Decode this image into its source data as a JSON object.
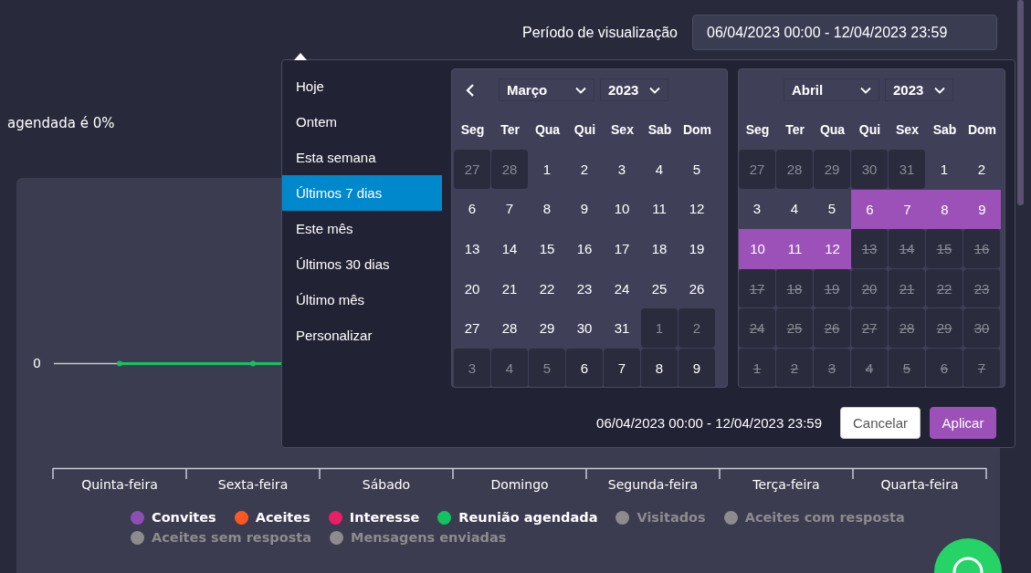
{
  "header": {
    "label": "Período de visualização",
    "range_value": "06/04/2023 00:00 - 12/04/2023 23:59"
  },
  "summary": "agendada é 0%",
  "chart": {
    "y_tick": "0",
    "x_labels": [
      "Quinta-feira",
      "Sexta-feira",
      "Sábado",
      "Domingo",
      "Segunda-feira",
      "Terça-feira",
      "Quarta-feira"
    ],
    "legend": [
      {
        "label": "Convites",
        "color": "#8e4fb5",
        "enabled": true
      },
      {
        "label": "Aceites",
        "color": "#ff5722",
        "enabled": true
      },
      {
        "label": "Interesse",
        "color": "#e91e63",
        "enabled": true
      },
      {
        "label": "Reunião agendada",
        "color": "#13c360",
        "enabled": true
      },
      {
        "label": "Visitados",
        "color": "#8c8c8c",
        "enabled": false
      },
      {
        "label": "Aceites com resposta",
        "color": "#8c8c8c",
        "enabled": false
      },
      {
        "label": "Aceites sem resposta",
        "color": "#8c8c8c",
        "enabled": false
      },
      {
        "label": "Mensagens enviadas",
        "color": "#8c8c8c",
        "enabled": false
      }
    ]
  },
  "date_picker": {
    "ranges": [
      {
        "label": "Hoje",
        "selected": false
      },
      {
        "label": "Ontem",
        "selected": false
      },
      {
        "label": "Esta semana",
        "selected": false
      },
      {
        "label": "Últimos 7 dias",
        "selected": true
      },
      {
        "label": "Este mês",
        "selected": false
      },
      {
        "label": "Últimos 30 dias",
        "selected": false
      },
      {
        "label": "Último mês",
        "selected": false
      },
      {
        "label": "Personalizar",
        "selected": false
      }
    ],
    "calendars": [
      {
        "prev_button": true,
        "month": "Março",
        "year": "2023",
        "weekdays": [
          "Seg",
          "Ter",
          "Qua",
          "Qui",
          "Sex",
          "Sab",
          "Dom"
        ],
        "days": [
          {
            "d": "27",
            "kind": "outside"
          },
          {
            "d": "28",
            "kind": "outside"
          },
          {
            "d": "1",
            "kind": "normal"
          },
          {
            "d": "2",
            "kind": "normal"
          },
          {
            "d": "3",
            "kind": "normal"
          },
          {
            "d": "4",
            "kind": "normal"
          },
          {
            "d": "5",
            "kind": "normal"
          },
          {
            "d": "6",
            "kind": "normal"
          },
          {
            "d": "7",
            "kind": "normal"
          },
          {
            "d": "8",
            "kind": "normal"
          },
          {
            "d": "9",
            "kind": "normal"
          },
          {
            "d": "10",
            "kind": "normal"
          },
          {
            "d": "11",
            "kind": "normal"
          },
          {
            "d": "12",
            "kind": "normal"
          },
          {
            "d": "13",
            "kind": "normal"
          },
          {
            "d": "14",
            "kind": "normal"
          },
          {
            "d": "15",
            "kind": "normal"
          },
          {
            "d": "16",
            "kind": "normal"
          },
          {
            "d": "17",
            "kind": "normal"
          },
          {
            "d": "18",
            "kind": "normal"
          },
          {
            "d": "19",
            "kind": "normal"
          },
          {
            "d": "20",
            "kind": "normal"
          },
          {
            "d": "21",
            "kind": "normal"
          },
          {
            "d": "22",
            "kind": "normal"
          },
          {
            "d": "23",
            "kind": "normal"
          },
          {
            "d": "24",
            "kind": "normal"
          },
          {
            "d": "25",
            "kind": "normal"
          },
          {
            "d": "26",
            "kind": "normal"
          },
          {
            "d": "27",
            "kind": "normal"
          },
          {
            "d": "28",
            "kind": "normal"
          },
          {
            "d": "29",
            "kind": "normal"
          },
          {
            "d": "30",
            "kind": "normal"
          },
          {
            "d": "31",
            "kind": "normal"
          },
          {
            "d": "1",
            "kind": "outside"
          },
          {
            "d": "2",
            "kind": "outside"
          },
          {
            "d": "3",
            "kind": "outside"
          },
          {
            "d": "4",
            "kind": "outside"
          },
          {
            "d": "5",
            "kind": "outside"
          },
          {
            "d": "6",
            "kind": "outside_range"
          },
          {
            "d": "7",
            "kind": "outside_range"
          },
          {
            "d": "8",
            "kind": "outside_range"
          },
          {
            "d": "9",
            "kind": "outside_range"
          }
        ]
      },
      {
        "prev_button": false,
        "month": "Abril",
        "year": "2023",
        "weekdays": [
          "Seg",
          "Ter",
          "Qua",
          "Qui",
          "Sex",
          "Sab",
          "Dom"
        ],
        "days": [
          {
            "d": "27",
            "kind": "outside"
          },
          {
            "d": "28",
            "kind": "outside"
          },
          {
            "d": "29",
            "kind": "outside"
          },
          {
            "d": "30",
            "kind": "outside"
          },
          {
            "d": "31",
            "kind": "outside"
          },
          {
            "d": "1",
            "kind": "normal"
          },
          {
            "d": "2",
            "kind": "normal"
          },
          {
            "d": "3",
            "kind": "normal"
          },
          {
            "d": "4",
            "kind": "normal"
          },
          {
            "d": "5",
            "kind": "normal"
          },
          {
            "d": "6",
            "kind": "in_range"
          },
          {
            "d": "7",
            "kind": "in_range"
          },
          {
            "d": "8",
            "kind": "in_range"
          },
          {
            "d": "9",
            "kind": "in_range"
          },
          {
            "d": "10",
            "kind": "in_range"
          },
          {
            "d": "11",
            "kind": "in_range"
          },
          {
            "d": "12",
            "kind": "in_range"
          },
          {
            "d": "13",
            "kind": "disabled"
          },
          {
            "d": "14",
            "kind": "disabled"
          },
          {
            "d": "15",
            "kind": "disabled"
          },
          {
            "d": "16",
            "kind": "disabled"
          },
          {
            "d": "17",
            "kind": "disabled"
          },
          {
            "d": "18",
            "kind": "disabled"
          },
          {
            "d": "19",
            "kind": "disabled"
          },
          {
            "d": "20",
            "kind": "disabled"
          },
          {
            "d": "21",
            "kind": "disabled"
          },
          {
            "d": "22",
            "kind": "disabled"
          },
          {
            "d": "23",
            "kind": "disabled"
          },
          {
            "d": "24",
            "kind": "disabled"
          },
          {
            "d": "25",
            "kind": "disabled"
          },
          {
            "d": "26",
            "kind": "disabled"
          },
          {
            "d": "27",
            "kind": "disabled"
          },
          {
            "d": "28",
            "kind": "disabled"
          },
          {
            "d": "29",
            "kind": "disabled"
          },
          {
            "d": "30",
            "kind": "disabled"
          },
          {
            "d": "1",
            "kind": "disabled"
          },
          {
            "d": "2",
            "kind": "disabled"
          },
          {
            "d": "3",
            "kind": "disabled"
          },
          {
            "d": "4",
            "kind": "disabled"
          },
          {
            "d": "5",
            "kind": "disabled"
          },
          {
            "d": "6",
            "kind": "disabled"
          },
          {
            "d": "7",
            "kind": "disabled"
          }
        ]
      }
    ],
    "selected_range": "06/04/2023 00:00 - 12/04/2023 23:59",
    "buttons": [
      {
        "label": "Cancelar",
        "kind": "secondary"
      },
      {
        "label": "Aplicar",
        "kind": "primary"
      }
    ]
  }
}
